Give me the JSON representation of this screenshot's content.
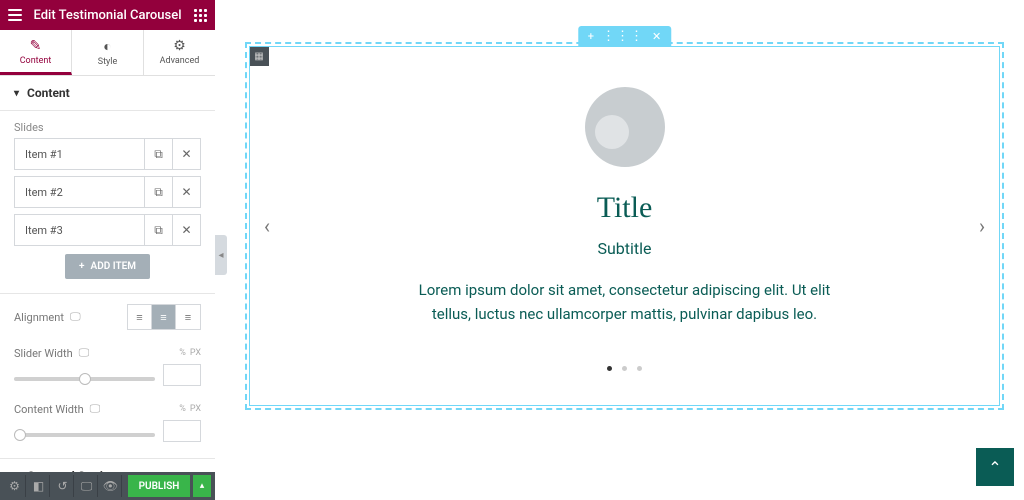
{
  "header": {
    "title": "Edit Testimonial Carousel"
  },
  "tabs": {
    "content": "Content",
    "style": "Style",
    "advanced": "Advanced"
  },
  "section": {
    "content_header": "Content",
    "slides_label": "Slides",
    "items": [
      "Item #1",
      "Item #2",
      "Item #3"
    ],
    "add_item": "ADD ITEM",
    "alignment_label": "Alignment",
    "slider_width_label": "Slider Width",
    "content_width_label": "Content Width",
    "unit": "PX",
    "carousel_settings": "Carousel Settings"
  },
  "bottom": {
    "publish": "PUBLISH"
  },
  "testimonial": {
    "title": "Title",
    "subtitle": "Subtitle",
    "text": "Lorem ipsum dolor sit amet, consectetur adipiscing elit. Ut elit tellus, luctus nec ullamcorper mattis, pulvinar dapibus leo."
  }
}
